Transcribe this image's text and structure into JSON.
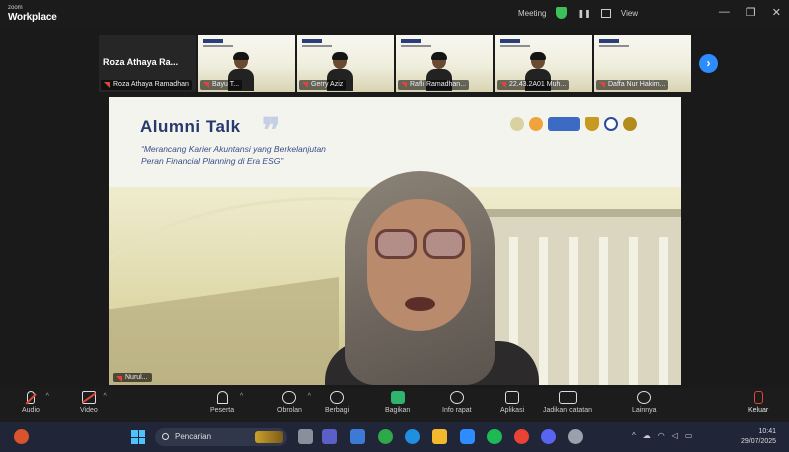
{
  "window": {
    "app_line1": "zoom",
    "app_line2": "Workplace",
    "center_status": "Meeting",
    "view_label": "View",
    "min_glyph": "—",
    "max_glyph": "❐",
    "close_glyph": "✕"
  },
  "gallery": {
    "first_tile_name": "Roza Athaya Ra...",
    "first_tile_label": "Roza Athaya Ramadhan",
    "tiles": [
      {
        "label": "Bayu T..."
      },
      {
        "label": "Gerry Aziz"
      },
      {
        "label": "Rafli Ramadhan..."
      },
      {
        "label": "22.43.2A01 Muh..."
      },
      {
        "label": "Daffa Nur Hakim..."
      }
    ],
    "next_glyph": "›"
  },
  "main_video": {
    "slide_title": "Alumni  Talk",
    "slide_subtitle_1": "“Merancang Karier Akuntansi yang Berkelanjutan",
    "slide_subtitle_2": "Peran Financial Planning di Era ESG”",
    "speaker_name": "Nurul..."
  },
  "toolbar": {
    "audio": "Audio",
    "video": "Video",
    "participants": "Peserta",
    "chat": "Obrolan",
    "reactions": "Berbagi",
    "share": "Bagikan",
    "info": "Info rapat",
    "apps": "Aplikasi",
    "notes": "Jadikan catatan",
    "more": "Lainnya",
    "leave": "Keluar",
    "caret": "^"
  },
  "taskbar": {
    "search_placeholder": "Pencarian",
    "tray_caret": "^",
    "time": "10:41",
    "date": "29/07/2025"
  },
  "colors": {
    "accent_blue": "#2d8cff",
    "share_green": "#2fb36f",
    "leave_red": "#e0453a",
    "slide_title": "#27396f"
  }
}
